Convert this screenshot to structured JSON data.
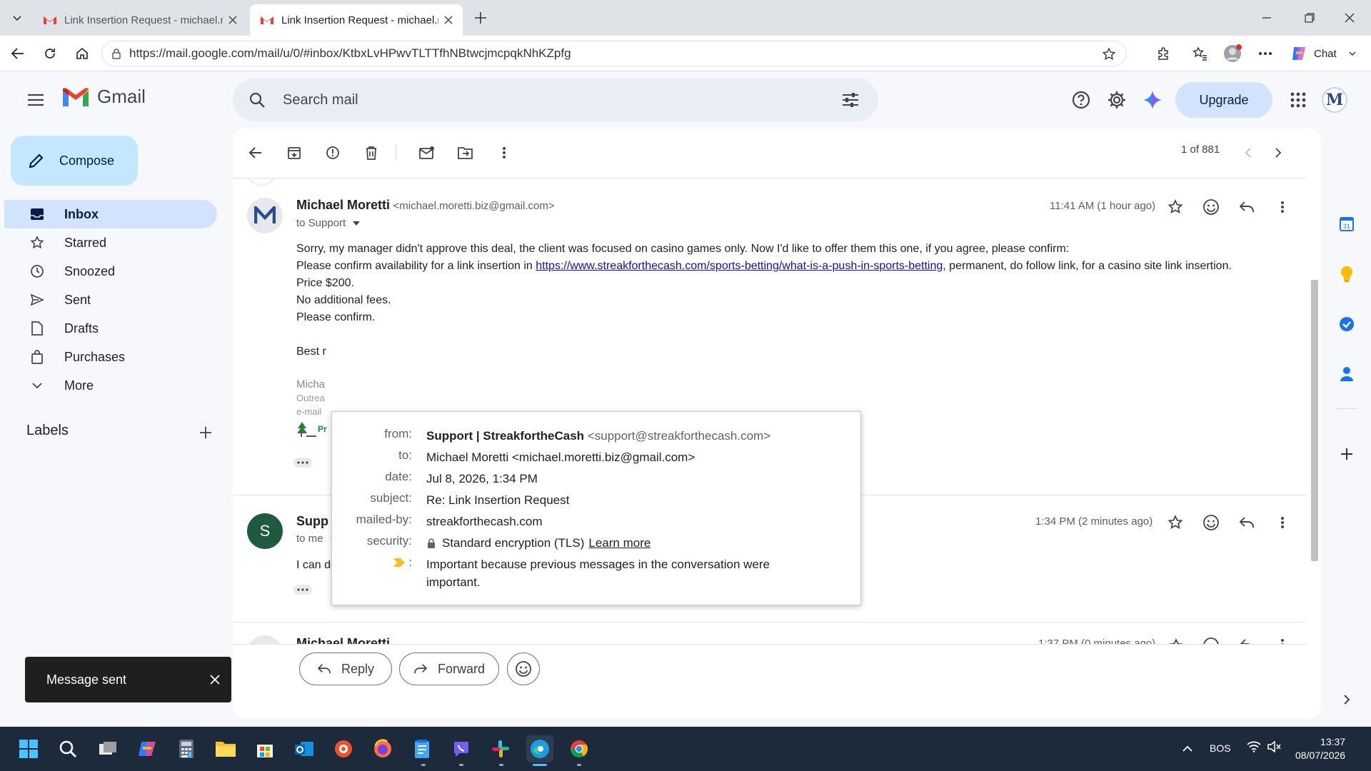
{
  "browser": {
    "tabs": [
      {
        "label": "Link Insertion Request - michael.m",
        "active": false
      },
      {
        "label": "Link Insertion Request - michael.m",
        "active": true
      }
    ],
    "url": "https://mail.google.com/mail/u/0/#inbox/KtbxLvHPwvTLTTfhNBtwcjmcpqkNhKZpfg",
    "chat_label": "Chat"
  },
  "gmail": {
    "logo": "Gmail",
    "search_placeholder": "Search mail",
    "upgrade_label": "Upgrade",
    "account_initial": "M",
    "compose_label": "Compose",
    "nav": [
      {
        "label": "Inbox",
        "icon": "inbox-icon",
        "active": true
      },
      {
        "label": "Starred",
        "icon": "star-icon"
      },
      {
        "label": "Snoozed",
        "icon": "clock-icon"
      },
      {
        "label": "Sent",
        "icon": "send-icon"
      },
      {
        "label": "Drafts",
        "icon": "draft-icon"
      },
      {
        "label": "Purchases",
        "icon": "bag-icon"
      },
      {
        "label": "More",
        "icon": "chevron-down-icon"
      }
    ],
    "labels_heading": "Labels",
    "counter": "1 of 881"
  },
  "thread": {
    "msg1": {
      "avatar": "M",
      "sender": "Michael Moretti",
      "email": "<michael.moretti.biz@gmail.com>",
      "to": "to Support",
      "time": "11:41 AM (1 hour ago)",
      "line1": "Sorry, my manager didn't approve this deal, the client was focused on casino games only. Now I'd like to offer them this one, if you agree, please confirm:",
      "line2_pre": "Please confirm availability for a link insertion in ",
      "line2_link": "https://www.streakforthecash.com/sports-betting/what-is-a-push-in-sports-betting",
      "line2_post": ", permanent, do follow link, for a casino site link insertion.",
      "line3": "Price  $200.",
      "line4": "No additional fees.",
      "line5": "Please confirm.",
      "line6": "Best r",
      "sig1": "Micha",
      "sig2": "Outrea",
      "sig3": "e-mail",
      "sig4": "Pr"
    },
    "msg2": {
      "avatar": "S",
      "sender": "Supp",
      "to": "to me",
      "time": "1:34 PM (2 minutes ago)",
      "body": "I can do that"
    },
    "msg3": {
      "sender": "Michael Moretti",
      "time": "1:37 PM (0 minutes ago)"
    },
    "reply_label": "Reply",
    "forward_label": "Forward"
  },
  "popup": {
    "from_label": "from:",
    "from_name": "Support | StreakfortheCash",
    "from_email": "<support@streakforthecash.com>",
    "to_label": "to:",
    "to_value": "Michael Moretti <michael.moretti.biz@gmail.com>",
    "date_label": "date:",
    "date_value": "Jul 8, 2026, 1:34 PM",
    "subject_label": "subject:",
    "subject_value": "Re: Link Insertion Request",
    "mailedby_label": "mailed-by:",
    "mailedby_value": "streakforthecash.com",
    "security_label": "security:",
    "security_value": "Standard encryption (TLS)",
    "learn_more": "Learn more",
    "important_label": ":",
    "important_value": "Important because previous messages in the conversation were important."
  },
  "toast": {
    "text": "Message sent"
  },
  "taskbar": {
    "lang": "BOS",
    "time": "13:37",
    "date": "08/07/2026"
  },
  "colors": {
    "gmail_red": "#ea4335",
    "compose_bg": "#c2e7ff",
    "inbox_active": "#d3e3fd",
    "link": "#1a0dab",
    "taskbar": "#1c2a3c"
  }
}
